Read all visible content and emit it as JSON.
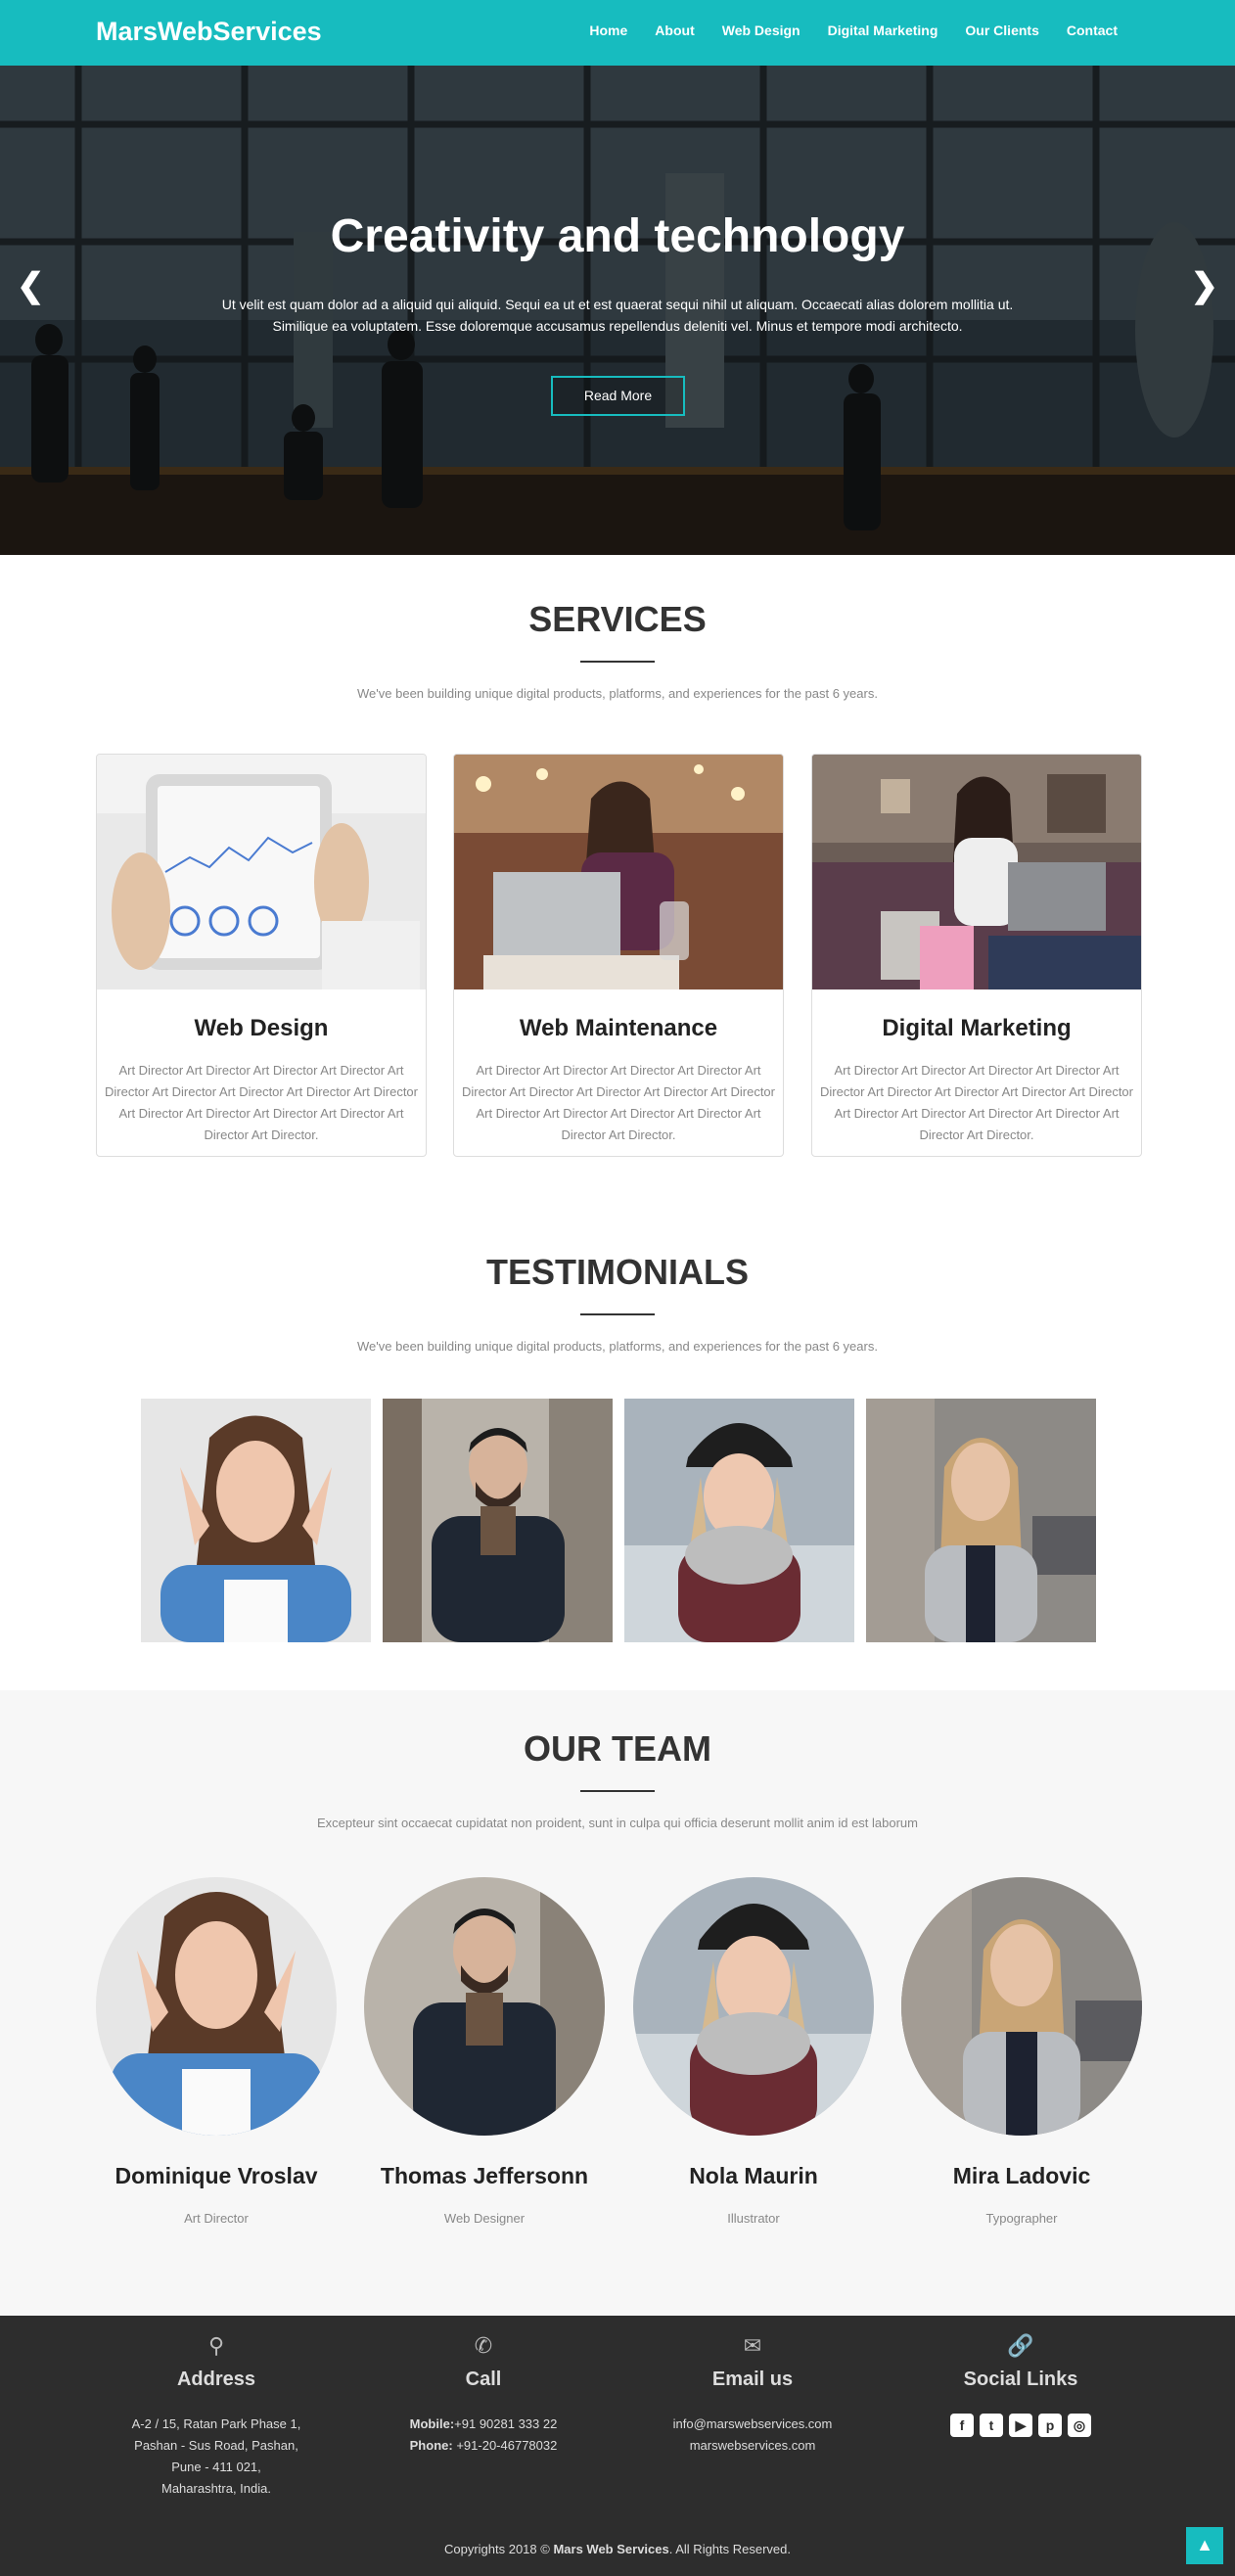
{
  "nav": {
    "brand": "MarsWebServices",
    "links": [
      "Home",
      "About",
      "Web Design",
      "Digital Marketing",
      "Our Clients",
      "Contact"
    ]
  },
  "hero": {
    "title": "Creativity and technology",
    "text": "Ut velit est quam dolor ad a aliquid qui aliquid. Sequi ea ut et est quaerat sequi nihil ut aliquam. Occaecati alias dolorem mollitia ut. Similique ea voluptatem. Esse doloremque accusamus repellendus deleniti vel. Minus et tempore modi architecto.",
    "button": "Read More",
    "prev_icon": "chevron-left-icon",
    "next_icon": "chevron-right-icon"
  },
  "services": {
    "title": "SERVICES",
    "subtitle": "We've been building unique digital products, platforms, and experiences for the past 6 years.",
    "cards": [
      {
        "title": "Web Design",
        "text": "Art Director Art Director Art Director Art Director Art Director Art Director Art Director Art Director Art Director Art Director Art Director Art Director Art Director Art Director Art Director."
      },
      {
        "title": "Web Maintenance",
        "text": "Art Director Art Director Art Director Art Director Art Director Art Director Art Director Art Director Art Director Art Director Art Director Art Director Art Director Art Director Art Director."
      },
      {
        "title": "Digital Marketing",
        "text": "Art Director Art Director Art Director Art Director Art Director Art Director Art Director Art Director Art Director Art Director Art Director Art Director Art Director Art Director Art Director."
      }
    ]
  },
  "testimonials": {
    "title": "TESTIMONIALS",
    "subtitle": "We've been building unique digital products, platforms, and experiences for the past 6 years."
  },
  "team": {
    "title": "OUR TEAM",
    "subtitle": "Excepteur sint occaecat cupidatat non proident, sunt in culpa qui officia deserunt mollit anim id est laborum",
    "members": [
      {
        "name": "Dominique Vroslav",
        "role": "Art Director"
      },
      {
        "name": "Thomas Jeffersonn",
        "role": "Web Designer"
      },
      {
        "name": "Nola Maurin",
        "role": "Illustrator"
      },
      {
        "name": "Mira Ladovic",
        "role": "Typographer"
      }
    ]
  },
  "footer": {
    "address": {
      "icon": "map-pin-icon",
      "title": "Address",
      "lines": [
        "A-2 / 15, Ratan Park Phase 1,",
        "Pashan - Sus Road, Pashan,",
        "Pune - 411 021,",
        "Maharashtra, India."
      ]
    },
    "call": {
      "icon": "phone-icon",
      "title": "Call",
      "mobile_label": "Mobile:",
      "mobile": "+91 90281 333 22",
      "phone_label": "Phone:",
      "phone": "+91-20-46778032"
    },
    "email": {
      "icon": "envelope-icon",
      "title": "Email us",
      "lines": [
        "info@marswebservices.com",
        "marswebservices.com"
      ]
    },
    "social": {
      "icon": "link-icon",
      "title": "Social Links",
      "icons": [
        "facebook-icon",
        "twitter-icon",
        "youtube-icon",
        "pinterest-icon",
        "dribbble-icon"
      ]
    },
    "copyright_pre": "Copyrights 2018 © ",
    "copyright_brand": "Mars Web Services",
    "copyright_post": ". All Rights Reserved.",
    "to_top_icon": "chevron-up-icon"
  },
  "colors": {
    "accent": "#17bcbf",
    "footer_bg": "#2d2d2d",
    "team_bg": "#f7f7f7"
  }
}
